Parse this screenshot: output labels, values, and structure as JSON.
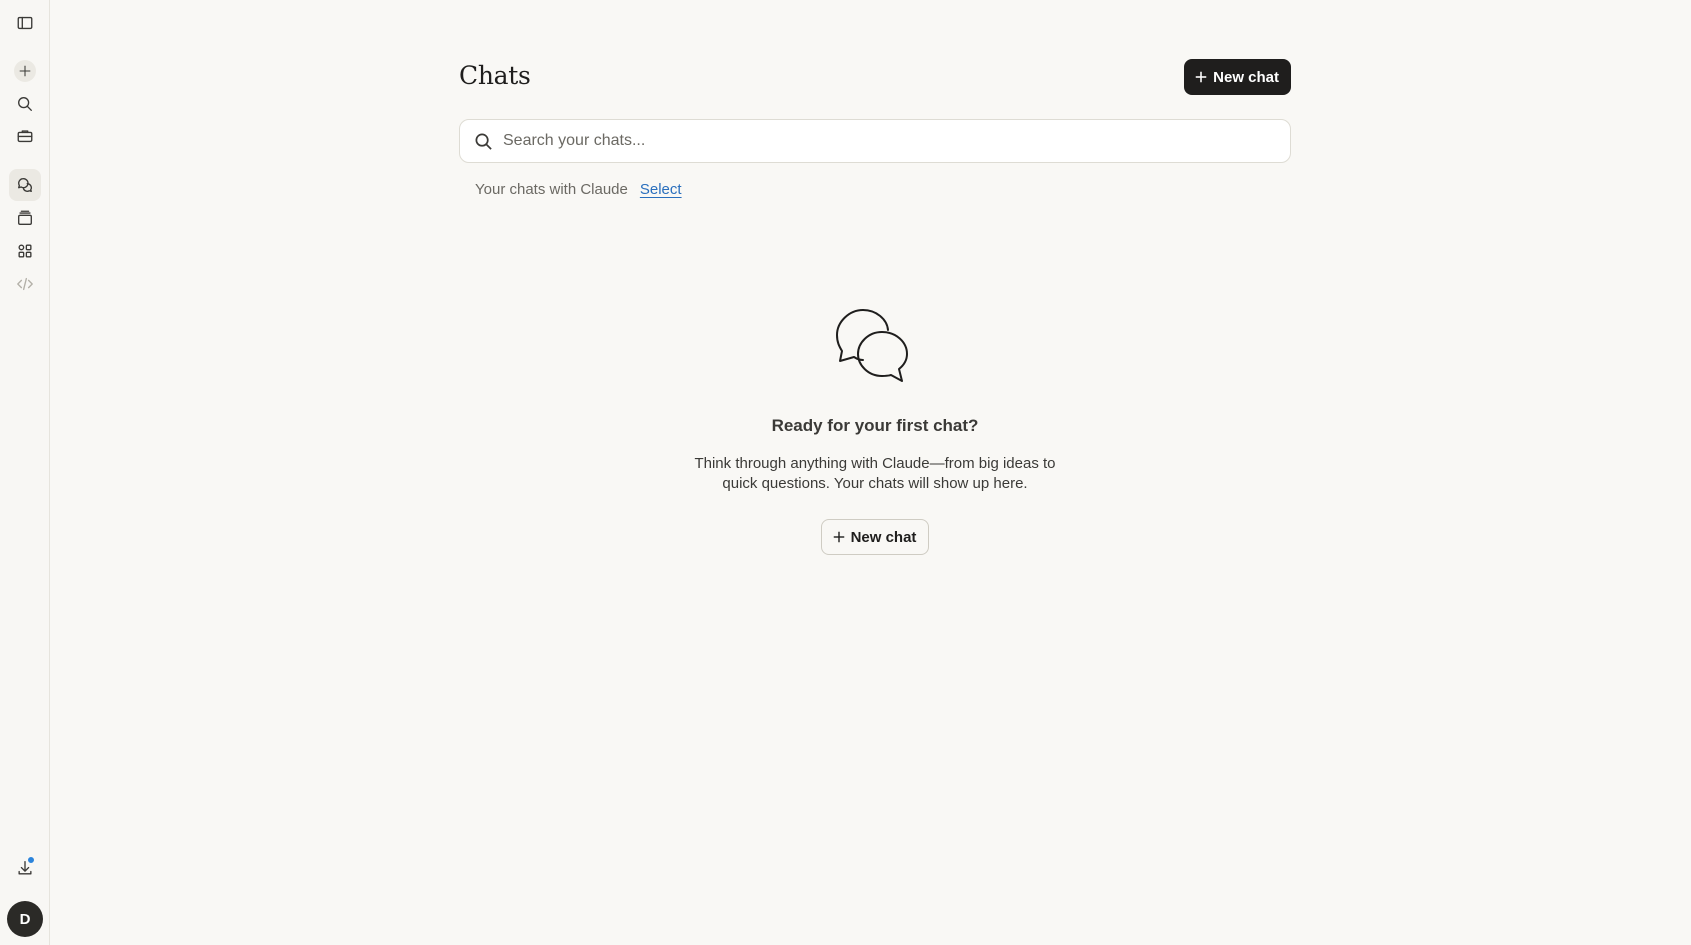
{
  "sidebar": {
    "items": [
      {
        "name": "sidebar-toggle",
        "icon": "sidebar-toggle-icon"
      },
      {
        "name": "new-chat",
        "icon": "plus-icon"
      },
      {
        "name": "search",
        "icon": "search-icon"
      },
      {
        "name": "projects",
        "icon": "briefcase-icon"
      },
      {
        "name": "chats",
        "icon": "chat-bubbles-icon",
        "active": true
      },
      {
        "name": "artifacts",
        "icon": "stack-icon"
      },
      {
        "name": "apps",
        "icon": "grid-icon"
      },
      {
        "name": "code",
        "icon": "code-icon"
      },
      {
        "name": "download",
        "icon": "download-icon",
        "notification": true
      }
    ],
    "avatar_initial": "D"
  },
  "header": {
    "title": "Chats",
    "new_chat_label": "New chat"
  },
  "search": {
    "placeholder": "Search your chats..."
  },
  "subline": {
    "text": "Your chats with Claude",
    "select_label": "Select"
  },
  "empty_state": {
    "icon": "chat-bubbles-icon",
    "title": "Ready for your first chat?",
    "text": "Think through anything with Claude—from big ideas to quick questions. Your chats will show up here.",
    "button_label": "New chat"
  },
  "colors": {
    "background": "#f9f8f5",
    "primary_button": "#1f1e1d",
    "link": "#2a6fbd",
    "notification_dot": "#2c84db"
  }
}
